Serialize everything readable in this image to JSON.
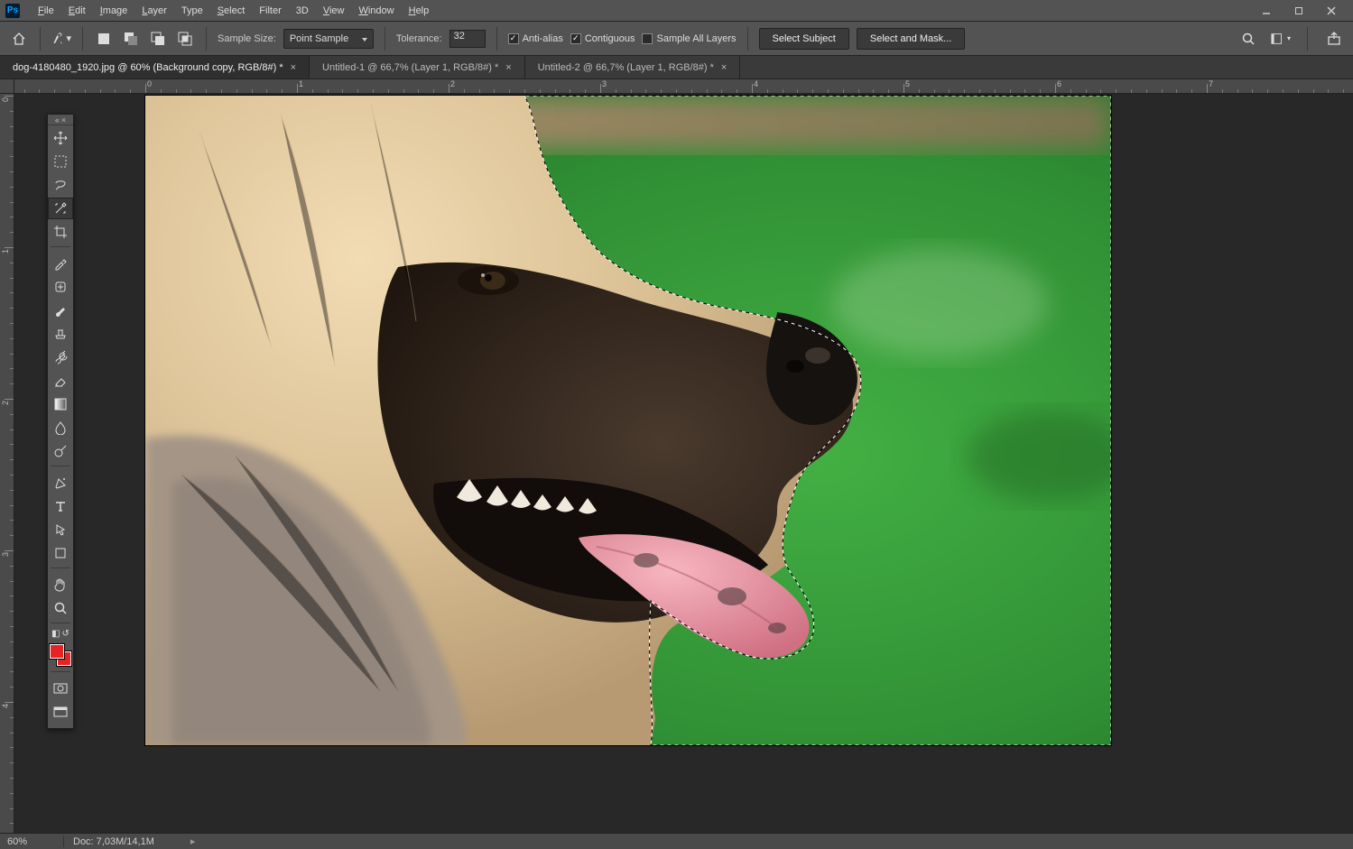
{
  "menu": {
    "items": [
      "File",
      "Edit",
      "Image",
      "Layer",
      "Type",
      "Select",
      "Filter",
      "3D",
      "View",
      "Window",
      "Help"
    ]
  },
  "options": {
    "sample_size_label": "Sample Size:",
    "sample_size_value": "Point Sample",
    "tolerance_label": "Tolerance:",
    "tolerance_value": "32",
    "anti_alias": "Anti-alias",
    "contiguous": "Contiguous",
    "sample_all": "Sample All Layers",
    "select_subject": "Select Subject",
    "select_and_mask": "Select and Mask..."
  },
  "tabs": [
    {
      "label": "dog-4180480_1920.jpg @ 60% (Background copy, RGB/8#) *",
      "active": true
    },
    {
      "label": "Untitled-1 @ 66,7% (Layer 1, RGB/8#) *",
      "active": false
    },
    {
      "label": "Untitled-2 @ 66,7% (Layer 1, RGB/8#) *",
      "active": false
    }
  ],
  "ruler": {
    "top_labels": [
      "0",
      "1",
      "2",
      "3",
      "4",
      "5",
      "6",
      "7"
    ],
    "left_labels": [
      "0",
      "1",
      "2",
      "3",
      "4"
    ]
  },
  "status": {
    "zoom": "60%",
    "doc": "Doc: 7,03M/14,1M"
  },
  "tools": {
    "names": [
      "move",
      "marquee",
      "lasso",
      "magic-wand",
      "crop",
      "eyedropper",
      "healing",
      "brush",
      "stamp",
      "history-brush",
      "eraser",
      "gradient",
      "blur",
      "dodge",
      "pen",
      "type",
      "path-select",
      "rectangle",
      "hand",
      "zoom"
    ]
  }
}
